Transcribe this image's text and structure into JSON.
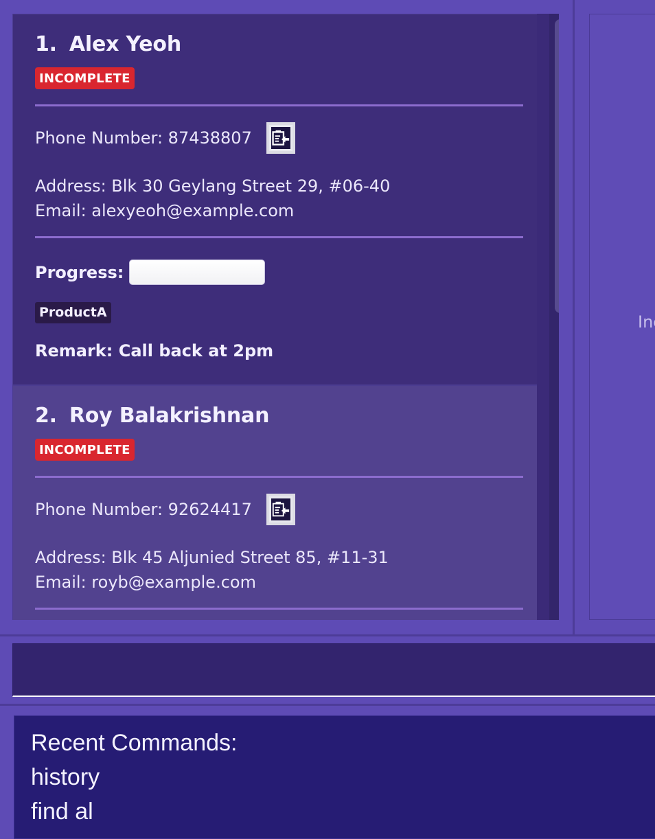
{
  "persons": [
    {
      "index": "1.",
      "name": "Alex Yeoh",
      "status": "INCOMPLETE",
      "phone": "Phone Number: 87438807",
      "address": "Address: Blk 30 Geylang Street 29, #06-40",
      "email": "Email: alexyeoh@example.com",
      "progress_label": "Progress:",
      "progress_value": 0,
      "tag": "ProductA",
      "remark": "Remark: Call back at 2pm"
    },
    {
      "index": "2.",
      "name": "Roy Balakrishnan",
      "status": "INCOMPLETE",
      "phone": "Phone Number: 92624417",
      "address": "Address: Blk 45 Aljunied Street 85, #11-31",
      "email": "Email: royb@example.com"
    }
  ],
  "detail_panel": {
    "partial_text": "Inc"
  },
  "command_box": {
    "value": ""
  },
  "result_display": {
    "lines": [
      "Recent Commands:",
      "history",
      "find al"
    ]
  },
  "colors": {
    "background": "#5e4bb5",
    "status_incomplete": "#d9262f",
    "divider": "#8c6cce",
    "tag_bg": "#2a1a48"
  },
  "icons": {
    "copy": "clipboard-copy-icon"
  }
}
